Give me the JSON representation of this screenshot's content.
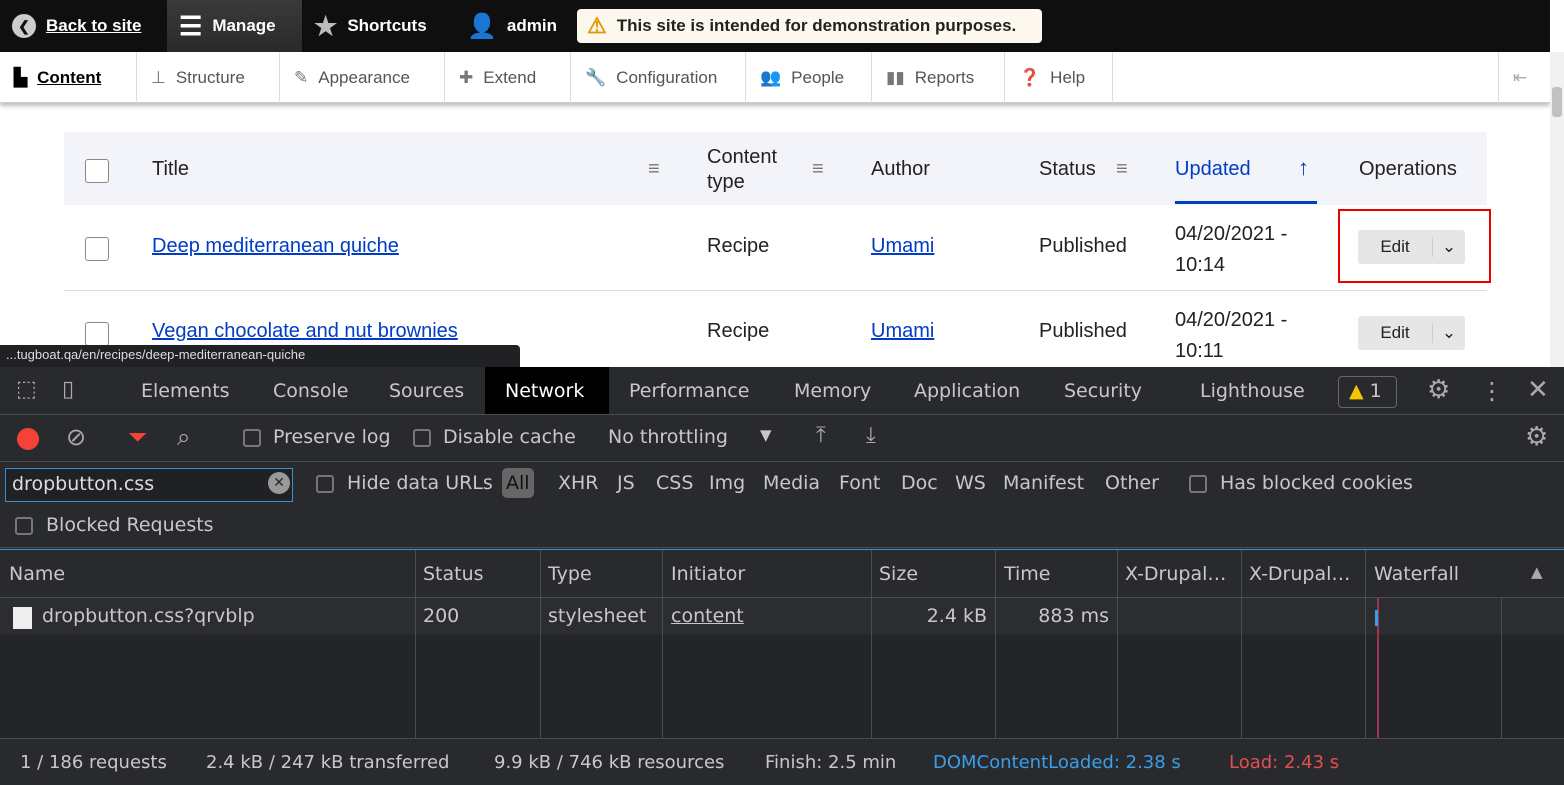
{
  "toolbar": {
    "back": "Back to site",
    "manage": "Manage",
    "shortcuts": "Shortcuts",
    "user": "admin",
    "notice": "This site is intended for demonstration purposes."
  },
  "tray": {
    "items": [
      {
        "label": "Content",
        "icon": "file-icon"
      },
      {
        "label": "Structure",
        "icon": "sitemap-icon"
      },
      {
        "label": "Appearance",
        "icon": "paintbrush-icon"
      },
      {
        "label": "Extend",
        "icon": "puzzle-icon"
      },
      {
        "label": "Configuration",
        "icon": "wrench-icon"
      },
      {
        "label": "People",
        "icon": "people-icon"
      },
      {
        "label": "Reports",
        "icon": "bar-chart-icon"
      },
      {
        "label": "Help",
        "icon": "help-icon"
      }
    ]
  },
  "table": {
    "headers": {
      "title": "Title",
      "content_type": "Content type",
      "author": "Author",
      "status": "Status",
      "updated": "Updated",
      "operations": "Operations"
    },
    "rows": [
      {
        "title": "Deep mediterranean quiche",
        "type": "Recipe",
        "author": "Umami",
        "status": "Published",
        "updated": "04/20/2021 - 10:14",
        "edit": "Edit"
      },
      {
        "title": "Vegan chocolate and nut brownies",
        "type": "Recipe",
        "author": "Umami",
        "status": "Published",
        "updated": "04/20/2021 - 10:11",
        "edit": "Edit"
      }
    ]
  },
  "status_url": "...tugboat.qa/en/recipes/deep-mediterranean-quiche",
  "devtools": {
    "tabs": [
      "Elements",
      "Console",
      "Sources",
      "Network",
      "Performance",
      "Memory",
      "Application",
      "Security",
      "Lighthouse"
    ],
    "active_tab": "Network",
    "warnings": "1",
    "preserve_log": "Preserve log",
    "disable_cache": "Disable cache",
    "throttling": "No throttling",
    "filter_value": "dropbutton.css",
    "hide_data_urls": "Hide data URLs",
    "types": [
      "All",
      "XHR",
      "JS",
      "CSS",
      "Img",
      "Media",
      "Font",
      "Doc",
      "WS",
      "Manifest",
      "Other"
    ],
    "has_blocked_cookies": "Has blocked cookies",
    "blocked_requests": "Blocked Requests",
    "columns": [
      "Name",
      "Status",
      "Type",
      "Initiator",
      "Size",
      "Time",
      "X-Drupal…",
      "X-Drupal…",
      "Waterfall"
    ],
    "requests": [
      {
        "name": "dropbutton.css?qrvblp",
        "status": "200",
        "type": "stylesheet",
        "initiator": "content",
        "size": "2.4 kB",
        "time": "883 ms"
      }
    ],
    "footer": {
      "requests": "1 / 186 requests",
      "transferred": "2.4 kB / 247 kB transferred",
      "resources": "9.9 kB / 746 kB resources",
      "finish": "Finish: 2.5 min",
      "dcl": "DOMContentLoaded: 2.38 s",
      "load": "Load: 2.43 s"
    },
    "colors": {
      "dcl": "#3a9fe8",
      "load": "#e34f4f",
      "record": "#f44336"
    }
  }
}
